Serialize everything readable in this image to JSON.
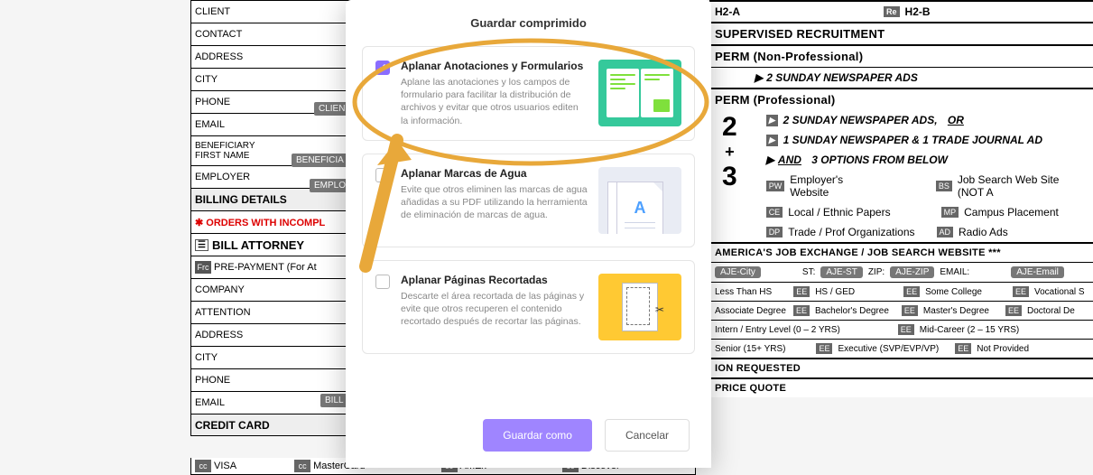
{
  "bg_header": {
    "h2a": "H2-A",
    "h2b": "H2-B"
  },
  "modal": {
    "title": "Guardar comprimido",
    "option1": {
      "title": "Aplanar Anotaciones y Formularios",
      "desc": "Aplane las anotaciones y los campos de formulario para facilitar la distribución de archivos y evitar que otros usuarios editen la información."
    },
    "option2": {
      "title": "Aplanar Marcas de Agua",
      "desc": "Evite que otros eliminen las marcas de agua añadidas a su PDF utilizando la herramienta de eliminación de marcas de agua."
    },
    "option3": {
      "title": "Aplanar Páginas Recortadas",
      "desc": "Descarte el área recortada de las páginas y evite que otros recuperen el contenido recortado después de recortar las páginas."
    },
    "save_label": "Guardar como",
    "cancel_label": "Cancelar"
  },
  "left_labels": {
    "client": "CLIENT",
    "contact": "CONTACT",
    "address": "ADDRESS",
    "city": "CITY",
    "phone": "PHONE",
    "email": "EMAIL",
    "benef1": "BENEFICIARY",
    "benef2": "FIRST NAME",
    "employer": "EMPLOYER",
    "billing": "BILLING DETAILS",
    "orders": "✱ ORDERS WITH INCOMPL",
    "bill_att": "BILL ATTORNEY",
    "prepay": "PRE-PAYMENT (For At",
    "company": "COMPANY",
    "attention": "ATTENTION",
    "address2": "ADDRESS",
    "city2": "CITY",
    "phone2": "PHONE",
    "email2": "EMAIL",
    "cc": "CREDIT CARD",
    "visa": "VISA",
    "mc": "MasterCard",
    "amex": "AmEx",
    "disc": "Discover",
    "pill_client": "CLIEN",
    "pill_benef": "BENEFICIA",
    "pill_empl": "EMPLO",
    "pill_bill": "BILL"
  },
  "right": {
    "sup_rec": "SUPERVISED RECRUITMENT",
    "perm_np": "PERM (Non-Professional)",
    "np_line": "2 SUNDAY NEWSPAPER ADS",
    "perm_p": "PERM (Professional)",
    "p1": "2 SUNDAY NEWSPAPER ADS,",
    "p1_or": "OR",
    "p2": "1 SUNDAY NEWSPAPER & 1 TRADE JOURNAL AD",
    "p3a": "AND",
    "p3b": "3 OPTIONS FROM BELOW",
    "big2": "2",
    "bigplus": "+",
    "big3": "3",
    "opt_pw": "Employer's Website",
    "opt_bs": "Job Search Web Site (NOT A",
    "opt_ce": "Local / Ethnic Papers",
    "opt_mp": "Campus Placement",
    "opt_dp": "Trade / Prof Organizations",
    "opt_ad": "Radio Ads",
    "aje_hdr": "AMERICA'S JOB EXCHANGE / JOB SEARCH WEBSITE ***",
    "aje_city": "AJE-City",
    "aje_st_lbl": "ST:",
    "aje_st": "AJE-ST",
    "aje_zip_lbl": "ZIP:",
    "aje_zip": "AJE-ZIP",
    "aje_email_lbl": "EMAIL:",
    "aje_email": "AJE-Email",
    "ed_less": "Less Than HS",
    "ed_hs": "HS / GED",
    "ed_sc": "Some College",
    "ed_voc": "Vocational S",
    "ed_assoc": "Associate Degree",
    "ed_bach": "Bachelor's Degree",
    "ed_mas": "Master's Degree",
    "ed_doc": "Doctoral De",
    "exp_intern": "Intern / Entry Level (0 – 2 YRS)",
    "exp_mid": "Mid-Career (2 – 15 YRS)",
    "exp_senior": "Senior (15+ YRS)",
    "exp_exec": "Executive (SVP/EVP/VP)",
    "exp_np": "Not Provided",
    "job_req": "ION REQUESTED",
    "price_q": "PRICE QUOTE",
    "tag_pw": "PW",
    "tag_bs": "BS",
    "tag_ce": "CE",
    "tag_mp": "MP",
    "tag_dp": "DP",
    "tag_ad": "AD",
    "tag_ee": "EE",
    "tag_re": "Re"
  }
}
